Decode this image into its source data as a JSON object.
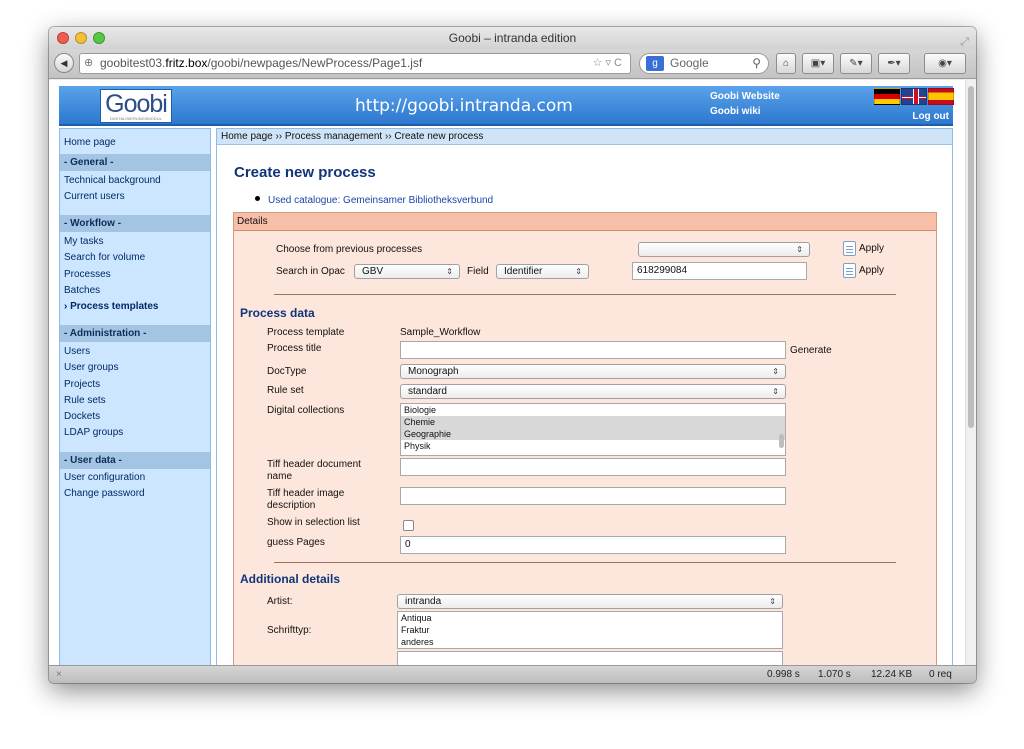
{
  "window": {
    "title": "Goobi – intranda edition"
  },
  "browser": {
    "url_domain": "goobitest03.",
    "url_host": "fritz.box",
    "url_path": "/goobi/newpages/NewProcess/Page1.jsf",
    "search_placeholder": "Google"
  },
  "header": {
    "logo_text": "Goobi",
    "logo_sub": "DIGITALISIERUNGSMODUL",
    "site_url": "http://goobi.intranda.com",
    "website_link": "Goobi Website",
    "wiki_link": "Goobi wiki",
    "logout": "Log out"
  },
  "sidebar": {
    "home": "Home page",
    "general_head": "- General -",
    "technical_background": "Technical background",
    "current_users": "Current users",
    "workflow_head": "- Workflow -",
    "my_tasks": "My tasks",
    "search_volume": "Search for volume",
    "processes": "Processes",
    "batches": "Batches",
    "process_templates": "› Process templates",
    "admin_head": "- Administration -",
    "users": "Users",
    "user_groups": "User groups",
    "projects": "Projects",
    "rule_sets": "Rule sets",
    "dockets": "Dockets",
    "ldap_groups": "LDAP groups",
    "userdata_head": "- User data -",
    "user_configuration": "User configuration",
    "change_password": "Change password"
  },
  "breadcrumb": "Home page ›› Process management ›› Create new process",
  "page_title": "Create new process",
  "catalogue_link": "Used catalogue: Gemeinsamer Bibliotheksverbund",
  "details": {
    "header": "Details",
    "choose_previous_label": "Choose from previous processes",
    "choose_previous_value": "",
    "apply1": "Apply",
    "search_opac_label": "Search in Opac",
    "opac_value": "GBV",
    "field_label": "Field",
    "field_value": "Identifier",
    "search_value": "618299084",
    "apply2": "Apply"
  },
  "process_data": {
    "title": "Process data",
    "template_label": "Process template",
    "template_value": "Sample_Workflow",
    "process_title_label": "Process title",
    "process_title_value": "",
    "generate": "Generate",
    "doctype_label": "DocType",
    "doctype_value": "Monograph",
    "ruleset_label": "Rule set",
    "ruleset_value": "standard",
    "collections_label": "Digital collections",
    "collections": [
      "Biologie",
      "Chemie",
      "Geographie",
      "Physik"
    ],
    "tiff_doc_label_1": "Tiff header document",
    "tiff_doc_label_2": "name",
    "tiff_doc_value": "",
    "tiff_img_label_1": "Tiff header image",
    "tiff_img_label_2": "description",
    "tiff_img_value": "",
    "show_selection_label": "Show in selection list",
    "guess_pages_label": "guess Pages",
    "guess_pages_value": "0"
  },
  "additional": {
    "title": "Additional details",
    "artist_label": "Artist:",
    "artist_value": "intranda",
    "schrifttyp_label": "Schrifttyp:",
    "schrifttyp_options": [
      "Antiqua",
      "Fraktur",
      "anderes"
    ]
  },
  "status": {
    "t1": "0.998 s",
    "t2": "1.070 s",
    "size": "12.24 KB",
    "req": "0 req"
  }
}
